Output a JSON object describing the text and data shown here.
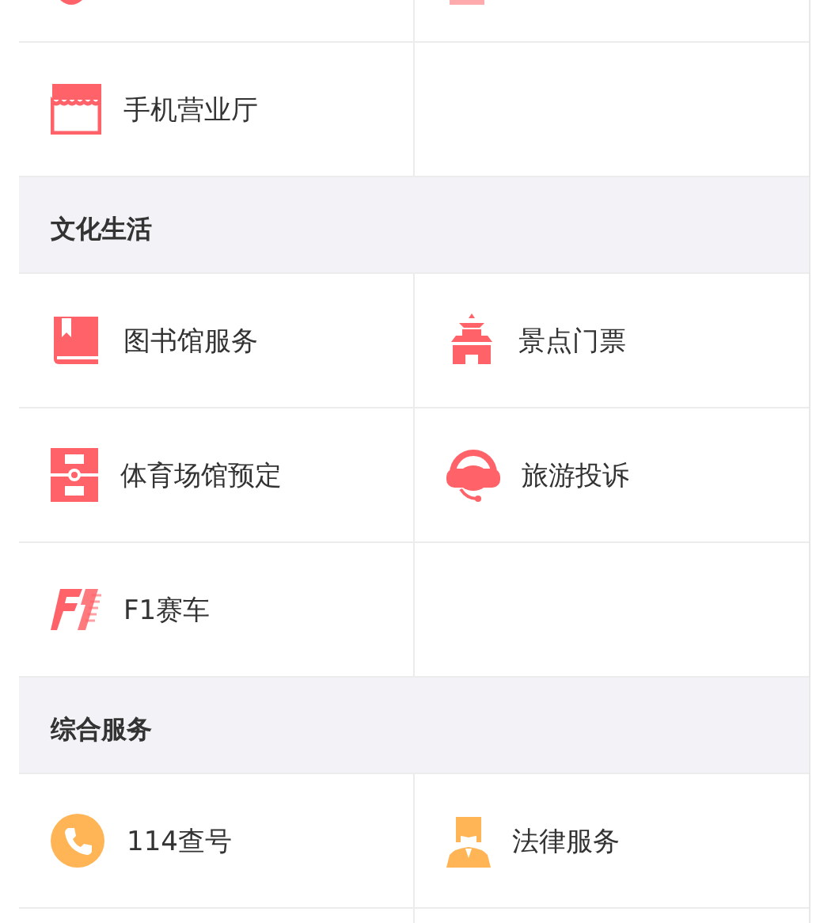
{
  "sections": [
    {
      "items": [
        {
          "label": "手机营业厅"
        }
      ]
    },
    {
      "title": "文化生活",
      "items": [
        {
          "label": "图书馆服务"
        },
        {
          "label": "景点门票"
        },
        {
          "label": "体育场馆预定"
        },
        {
          "label": "旅游投诉"
        },
        {
          "label": "F1赛车"
        }
      ]
    },
    {
      "title": "综合服务",
      "items": [
        {
          "label": "114查号"
        },
        {
          "label": "法律服务"
        }
      ]
    }
  ]
}
